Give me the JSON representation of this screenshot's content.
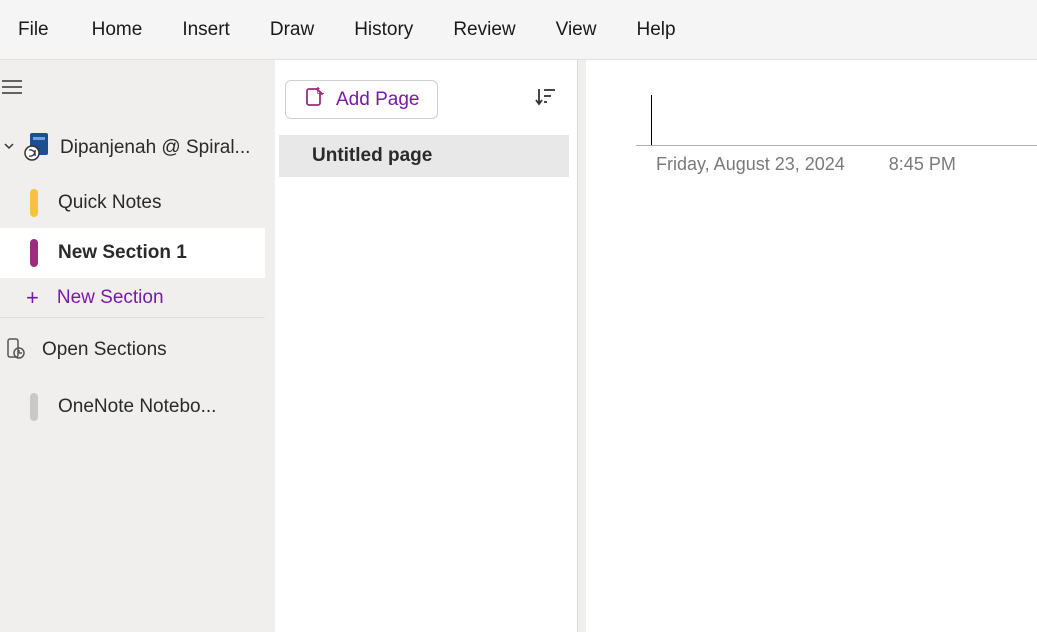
{
  "menubar": {
    "items": [
      "File",
      "Home",
      "Insert",
      "Draw",
      "History",
      "Review",
      "View",
      "Help"
    ]
  },
  "sidebar": {
    "notebook_title": "Dipanjenah @ Spiral...",
    "sections": [
      {
        "label": "Quick Notes",
        "color": "yellow",
        "active": false
      },
      {
        "label": "New Section 1",
        "color": "purple",
        "active": true
      }
    ],
    "new_section_label": "New Section",
    "open_sections_label": "Open Sections",
    "other_notebooks": [
      {
        "label": "OneNote Notebo..."
      }
    ]
  },
  "page_list": {
    "add_page_label": "Add Page",
    "pages": [
      {
        "label": "Untitled page"
      }
    ]
  },
  "editor": {
    "date": "Friday, August 23, 2024",
    "time": "8:45 PM"
  }
}
